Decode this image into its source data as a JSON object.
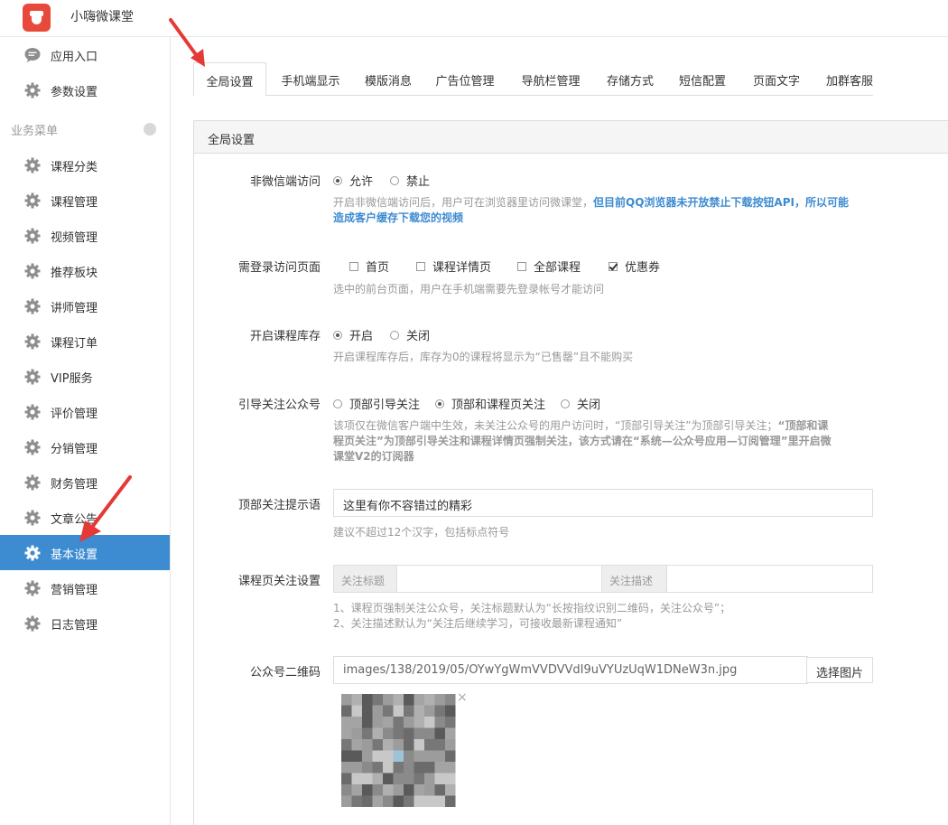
{
  "app": {
    "title": "小嗨微课堂"
  },
  "sidebar": {
    "top_items": [
      {
        "label": "应用入口",
        "icon": "chat-bubble-icon"
      },
      {
        "label": "参数设置",
        "icon": "gear-icon"
      }
    ],
    "group_label": "业务菜单",
    "items": [
      {
        "label": "课程分类"
      },
      {
        "label": "课程管理"
      },
      {
        "label": "视频管理"
      },
      {
        "label": "推荐板块"
      },
      {
        "label": "讲师管理"
      },
      {
        "label": "课程订单"
      },
      {
        "label": "VIP服务"
      },
      {
        "label": "评价管理"
      },
      {
        "label": "分销管理"
      },
      {
        "label": "财务管理"
      },
      {
        "label": "文章公告"
      },
      {
        "label": "基本设置",
        "active": true
      },
      {
        "label": "营销管理"
      },
      {
        "label": "日志管理"
      }
    ]
  },
  "tabs": [
    {
      "label": "全局设置",
      "active": true
    },
    {
      "label": "手机端显示"
    },
    {
      "label": "模版消息"
    },
    {
      "label": "广告位管理"
    },
    {
      "label": "导航栏管理"
    },
    {
      "label": "存储方式"
    },
    {
      "label": "短信配置"
    },
    {
      "label": "页面文字"
    },
    {
      "label": "加群客服"
    }
  ],
  "panel": {
    "title": "全局设置",
    "non_wechat": {
      "label": "非微信端访问",
      "options": [
        "允许",
        "禁止"
      ],
      "selected": "允许",
      "help_plain": "开启非微信端访问后，用户可在浏览器里访问微课堂，",
      "help_bold_line1": "但目前QQ浏览器未开放禁止下载按钮API，所以可能",
      "help_bold_line2": "造成客户缓存下载您的视频"
    },
    "login_pages": {
      "label": "需登录访问页面",
      "options": [
        {
          "label": "首页",
          "checked": false
        },
        {
          "label": "课程详情页",
          "checked": false
        },
        {
          "label": "全部课程",
          "checked": false
        },
        {
          "label": "优惠券",
          "checked": true
        }
      ],
      "help": "选中的前台页面，用户在手机端需要先登录帐号才能访问"
    },
    "stock": {
      "label": "开启课程库存",
      "options": [
        "开启",
        "关闭"
      ],
      "selected": "开启",
      "help": "开启课程库存后，库存为0的课程将显示为“已售罄”且不能购买"
    },
    "follow": {
      "label": "引导关注公众号",
      "options": [
        "顶部引导关注",
        "顶部和课程页关注",
        "关闭"
      ],
      "selected": "顶部和课程页关注",
      "help_line1_plain": "该项仅在微信客户端中生效，未关注公众号的用户访问时，“顶部引导关注”为顶部引导关注；",
      "help_line1_bold": "“顶部和课",
      "help_line2_bold": "程页关注”为顶部引导关注和课程详情页强制关注，该方式请在“系统—公众号应用—订阅管理”里开启微",
      "help_line3_bold": "课堂V2的订阅器"
    },
    "top_tip": {
      "label": "顶部关注提示语",
      "value": "这里有你不容错过的精彩",
      "help": "建议不超过12个汉字，包括标点符号"
    },
    "course_follow": {
      "label": "课程页关注设置",
      "addon_title": "关注标题",
      "addon_desc": "关注描述",
      "title_value": "",
      "desc_value": "",
      "help_line1": "1、课程页强制关注公众号，关注标题默认为“长按指纹识别二维码，关注公众号”；",
      "help_line2": "2、关注描述默认为“关注后继续学习，可接收最新课程通知”"
    },
    "qrcode": {
      "label": "公众号二维码",
      "path": "images/138/2019/05/OYwYgWmVVDVVdI9uVYUzUqW1DNeW3n.jpg",
      "pick_button": "选择图片",
      "close_glyph": "×"
    }
  },
  "colors": {
    "accent": "#3d8bd0",
    "logo": "#e8493a",
    "arrow": "#e53935"
  }
}
